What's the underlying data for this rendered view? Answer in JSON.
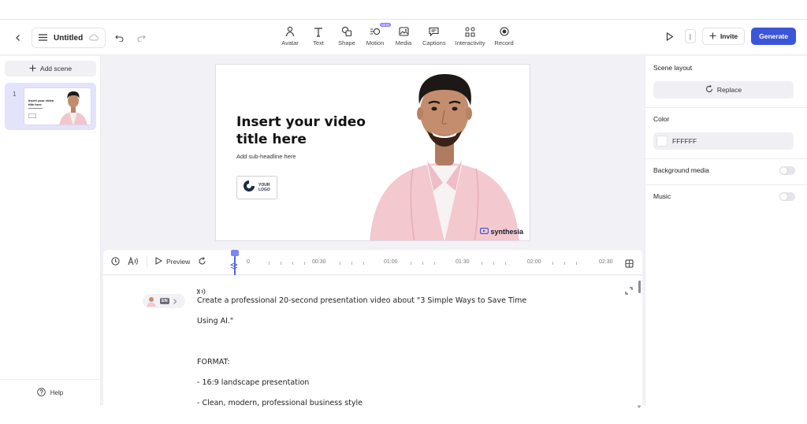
{
  "topbar": {
    "title": "Untitled",
    "tools": [
      {
        "label": "Avatar",
        "icon": "avatar-icon"
      },
      {
        "label": "Text",
        "icon": "text-icon"
      },
      {
        "label": "Shape",
        "icon": "shape-icon"
      },
      {
        "label": "Motion",
        "icon": "motion-icon",
        "badge": "NEW"
      },
      {
        "label": "Media",
        "icon": "media-icon"
      },
      {
        "label": "Captions",
        "icon": "captions-icon"
      },
      {
        "label": "Interactivity",
        "icon": "interactivity-icon"
      },
      {
        "label": "Record",
        "icon": "record-icon"
      }
    ],
    "separator_label": "|",
    "invite_label": "Invite",
    "generate_label": "Generate"
  },
  "sidebar": {
    "add_scene_label": "Add scene",
    "scene_number": "1",
    "thumb_title": "Insert your video title here",
    "help_label": "Help"
  },
  "slide": {
    "title": "Insert your video title here",
    "subtitle": "Add sub-headline here",
    "logo_text": "YOUR LOGO",
    "brand": "synthesia"
  },
  "timeline": {
    "preview_label": "Preview",
    "ticks": [
      "0",
      "00:30",
      "01:00",
      "01:30",
      "02:00",
      "02:30"
    ]
  },
  "script": {
    "language_badge": "EN",
    "lines": [
      "Create a professional 20-second presentation video about \"3 Simple Ways to Save Time",
      "Using AI.\"",
      "",
      "FORMAT:",
      "- 16:9 landscape presentation",
      "- Clean, modern, professional business style"
    ]
  },
  "right_panel": {
    "scene_layout_label": "Scene layout",
    "replace_label": "Replace",
    "color_label": "Color",
    "color_value": "FFFFFF",
    "background_media_label": "Background media",
    "background_media_on": false,
    "music_label": "Music",
    "music_on": false
  },
  "colors": {
    "accent": "#3b56d8",
    "scene_selected": "#e3e4fb",
    "new_badge": "#8a7cf5"
  }
}
